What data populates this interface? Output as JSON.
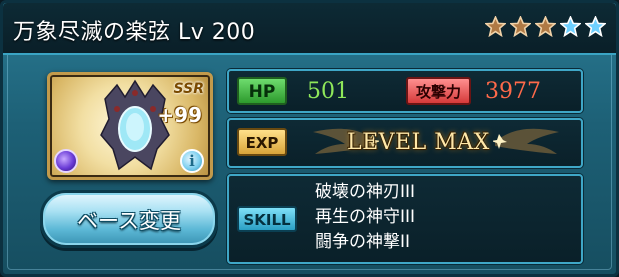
{
  "header": {
    "title": "万象尽滅の楽弦 Lv 200"
  },
  "stars": [
    {
      "type": "bronze"
    },
    {
      "type": "bronze"
    },
    {
      "type": "bronze"
    },
    {
      "type": "blue"
    },
    {
      "type": "blue"
    }
  ],
  "colors": {
    "bronze_star": "#b07a45",
    "blue_star": "#6fd0ff"
  },
  "portrait": {
    "rarity": "SSR",
    "uncap": "+99",
    "element_icon": "dark-element-icon",
    "info_label": "i"
  },
  "base_button": {
    "label": "ベース変更"
  },
  "stats": {
    "hp_label": "HP",
    "hp_value": "501",
    "atk_label": "攻撃力",
    "atk_value": "3977"
  },
  "exp": {
    "label": "EXP",
    "status": "LEVEL MAX"
  },
  "skills": {
    "label": "SKILL",
    "items": [
      "破壊の神刃III",
      "再生の神守III",
      "闘争の神撃II"
    ]
  }
}
